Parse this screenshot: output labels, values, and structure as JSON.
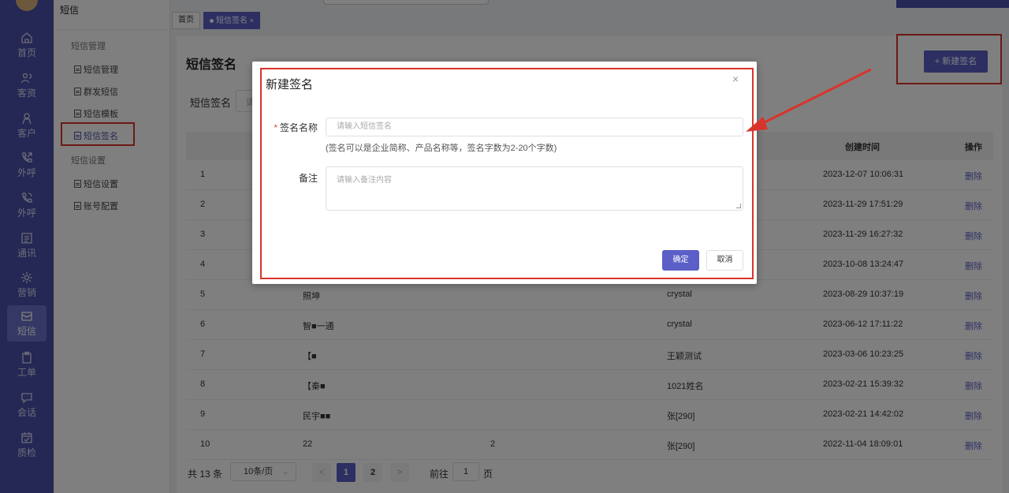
{
  "nav": {
    "items": [
      {
        "label": "首页",
        "icon": "home-icon"
      },
      {
        "label": "客资",
        "icon": "users-icon"
      },
      {
        "label": "客户",
        "icon": "customer-icon"
      },
      {
        "label": "外呼",
        "icon": "phone-out-icon"
      },
      {
        "label": "外呼",
        "icon": "phone-call-icon"
      },
      {
        "label": "通讯",
        "icon": "contacts-icon"
      },
      {
        "label": "营销",
        "icon": "gear-icon"
      },
      {
        "label": "短信",
        "icon": "message-icon"
      },
      {
        "label": "工单",
        "icon": "clipboard-icon"
      },
      {
        "label": "会话",
        "icon": "chat-icon"
      },
      {
        "label": "质检",
        "icon": "calendar-check-icon"
      }
    ],
    "active_index": 7
  },
  "submenu": {
    "title": "短信",
    "group1": "短信管理",
    "group1_items": [
      "短信管理",
      "群发短信",
      "短信模板",
      "短信签名"
    ],
    "group2": "短信设置",
    "group2_items": [
      "短信设置",
      "账号配置"
    ],
    "active_item": "短信签名"
  },
  "tabs": [
    {
      "label": "首页"
    },
    {
      "label": "短信签名",
      "close": "×"
    }
  ],
  "page": {
    "title": "短信签名",
    "filter_label": "短信签名",
    "filter_placeholder": "请",
    "new_button": "+ 新建签名"
  },
  "table": {
    "headers": {
      "created": "创建时间",
      "action": "操作"
    },
    "rows": [
      {
        "no": "1",
        "name": "",
        "count": "",
        "creator": "",
        "time": "2023-12-07 10:06:31",
        "op": "删除"
      },
      {
        "no": "2",
        "name": "",
        "count": "",
        "creator": "",
        "time": "2023-11-29 17:51:29",
        "op": "删除"
      },
      {
        "no": "3",
        "name": "",
        "count": "",
        "creator": "",
        "time": "2023-11-29 16:27:32",
        "op": "删除"
      },
      {
        "no": "4",
        "name": "",
        "count": "",
        "creator": "",
        "time": "2023-10-08 13:24:47",
        "op": "删除"
      },
      {
        "no": "5",
        "name": "照坤",
        "count": "",
        "creator": "crystal",
        "time": "2023-08-29 10:37:19",
        "op": "删除"
      },
      {
        "no": "6",
        "name": "智■一通",
        "count": "",
        "creator": "crystal",
        "time": "2023-06-12 17:11:22",
        "op": "删除"
      },
      {
        "no": "7",
        "name": "【■",
        "count": "",
        "creator": "王颖测试",
        "time": "2023-03-06 10:23:25",
        "op": "删除"
      },
      {
        "no": "8",
        "name": "【秦■",
        "count": "",
        "creator": "1021姓名",
        "time": "2023-02-21 15:39:32",
        "op": "删除"
      },
      {
        "no": "9",
        "name": "民宇■■",
        "count": "",
        "creator": "张[290]",
        "time": "2023-02-21 14:42:02",
        "op": "删除"
      },
      {
        "no": "10",
        "name": "22",
        "count": "2",
        "creator": "张[290]",
        "time": "2022-11-04 18:09:01",
        "op": "删除"
      }
    ]
  },
  "pager": {
    "total": "共 13 条",
    "page_size": "10条/页",
    "prev": "<",
    "next": ">",
    "pages": [
      "1",
      "2"
    ],
    "current": "1",
    "goto_label": "前往",
    "goto_value": "1",
    "goto_unit": "页"
  },
  "dialog": {
    "title": "新建签名",
    "close": "×",
    "name_label": "签名名称",
    "required_mark": "*",
    "name_placeholder": "请输入短信签名",
    "name_help": "(签名可以是企业简称、产品名称等，签名字数为2-20个字数)",
    "remark_label": "备注",
    "remark_placeholder": "请输入备注内容",
    "ok": "确定",
    "cancel": "取消"
  },
  "colors": {
    "brand": "#4b4fa8",
    "primary": "#5b5fc7",
    "annotation": "#d8342b"
  }
}
